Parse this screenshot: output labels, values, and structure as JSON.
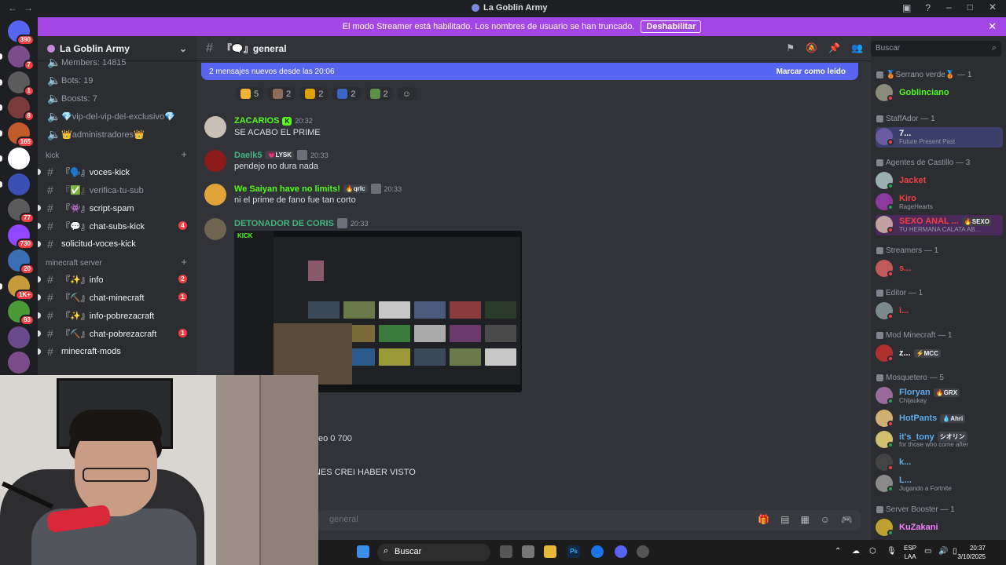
{
  "window": {
    "title": "La Goblin Army"
  },
  "banner": {
    "text": "El modo Streamer está habilitado. Los nombres de usuario se han truncado.",
    "button": "Deshabilitar"
  },
  "guild_list": {
    "dm_badge": "390",
    "badges": [
      "7",
      "1",
      "8",
      "165",
      "",
      "",
      "77",
      "730",
      "20",
      "1K+",
      "93",
      "",
      ""
    ]
  },
  "server": {
    "name": "La Goblin Army",
    "members_line": "Members: 14815",
    "stats": [
      "Bots: 19",
      "Boosts: 7"
    ],
    "voice": [
      "💎vip-del-vip-del-exclusivo💎",
      "👑administradores👑"
    ],
    "categories": [
      {
        "name": "kick",
        "channels": [
          {
            "name": "『🗣️』voces-kick",
            "bright": true,
            "badge": ""
          },
          {
            "name": "『✅』verifica-tu-sub",
            "bright": false,
            "badge": ""
          },
          {
            "name": "『👾』script-spam",
            "bright": true,
            "badge": ""
          },
          {
            "name": "『💬』chat-subs-kick",
            "bright": true,
            "badge": "4"
          },
          {
            "name": "solicitud-voces-kick",
            "bright": true,
            "badge": ""
          }
        ]
      },
      {
        "name": "minecraft server",
        "channels": [
          {
            "name": "『✨』info",
            "bright": true,
            "badge": "2"
          },
          {
            "name": "『⛏️』chat-minecraft",
            "bright": true,
            "badge": "1"
          },
          {
            "name": "『✨』info-pobrezacraft",
            "bright": true,
            "badge": ""
          },
          {
            "name": "『⛏️』chat-pobrezacraft",
            "bright": true,
            "badge": "1"
          },
          {
            "name": "minecraft-mods",
            "bright": true,
            "badge": ""
          }
        ]
      }
    ]
  },
  "channel": {
    "name": "『🗨️』general",
    "composer_placeholder": "general"
  },
  "new_messages": {
    "text": "2 mensajes nuevos desde las 20:06",
    "action": "Marcar como leído"
  },
  "reactions": [
    {
      "count": "5",
      "color": "#f0b232"
    },
    {
      "count": "2",
      "color": "#8a6d5a"
    },
    {
      "count": "2",
      "color": "#e0a000"
    },
    {
      "count": "2",
      "color": "#3a66c4"
    },
    {
      "count": "2",
      "color": "#5c8f4a"
    }
  ],
  "messages": [
    {
      "author": "ZACARIOS",
      "color": "#53fc18",
      "time": "20:32",
      "tag": "",
      "text": "SE ACABO EL PRIME",
      "avatar": "#c8c0b4"
    },
    {
      "author": "Daelk5",
      "color": "#43b581",
      "time": "20:33",
      "tag": "💗LYSK",
      "text": "pendejo no dura nada",
      "avatar": "#8b1a1a"
    },
    {
      "author": "We Saiyan have no limits!",
      "color": "#53fc18",
      "time": "20:33",
      "tag": "🔥qrlc",
      "text": "ni el prime de fano fue tan corto",
      "avatar": "#e2a33a"
    },
    {
      "author": "DETONADOR DE CORIS",
      "color": "#43b581",
      "time": "20:33",
      "tag": "",
      "text": "",
      "avatar": "#6e6452"
    }
  ],
  "attachment": {
    "brand": "KICK"
  },
  "partial_texts": [
    "eo 0 700",
    "NES CREI HABER VISTO"
  ],
  "search_placeholder": "Buscar",
  "member_groups": [
    {
      "title": "🥉Serrano verde🥉 — 1",
      "members": [
        {
          "name": "Goblinciano",
          "color": "#53fc18",
          "status": ""
        }
      ]
    },
    {
      "title": "StaffAdor — 1",
      "members": [
        {
          "name": "7...",
          "color": "#f2f3f5",
          "status": "Future Present Past"
        }
      ]
    },
    {
      "title": "Agentes de Castillo — 3",
      "members": [
        {
          "name": "Jacket",
          "color": "#f23f43",
          "status": ""
        },
        {
          "name": "Kiro",
          "color": "#f23f43",
          "status": "RageHearts"
        },
        {
          "name": "SEXO ANAL ...",
          "color": "#f23f43",
          "status": "TU HERMANA CALATA AB...",
          "tag": "🔥SEXO"
        }
      ]
    },
    {
      "title": "Streamers — 1",
      "members": [
        {
          "name": "s...",
          "color": "#f23f43",
          "status": ""
        }
      ]
    },
    {
      "title": "Editor — 1",
      "members": [
        {
          "name": "i...",
          "color": "#f23f43",
          "status": ""
        }
      ]
    },
    {
      "title": "Mod Minecraft — 1",
      "members": [
        {
          "name": "z...",
          "color": "#f2f3f5",
          "status": "",
          "tag": "⚡MCC"
        }
      ]
    },
    {
      "title": "Mosquetero — 5",
      "members": [
        {
          "name": "Floryan",
          "color": "#5dadec",
          "status": "Chijaukay",
          "tag": "🔥GRX"
        },
        {
          "name": "HotPants",
          "color": "#5dadec",
          "status": "",
          "tag": "💧Ahri"
        },
        {
          "name": "it's_tony",
          "color": "#5dadec",
          "status": "for those who come after",
          "tag": "シオリン"
        },
        {
          "name": "k...",
          "color": "#5dadec",
          "status": ""
        },
        {
          "name": "L...",
          "color": "#5dadec",
          "status": "Jugando a Fortnite"
        }
      ]
    },
    {
      "title": "Server Booster — 1",
      "members": [
        {
          "name": "KuZakani",
          "color": "#f47fff",
          "status": ""
        }
      ]
    }
  ],
  "taskbar": {
    "search": "Buscar",
    "lang": "ESP\nLAA",
    "time": "20:37",
    "date": "3/10/2025"
  }
}
